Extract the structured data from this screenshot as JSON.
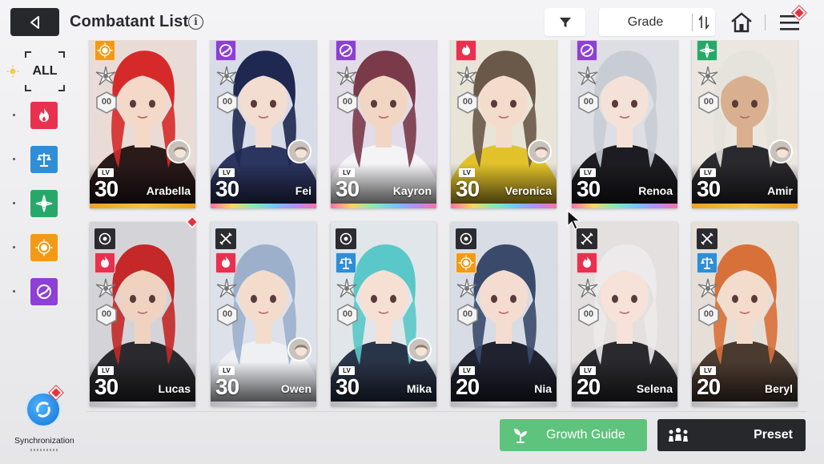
{
  "header": {
    "title": "Combatant List",
    "sort_label": "Grade"
  },
  "filter_rail": {
    "all_label": "ALL",
    "attributes": [
      {
        "id": "fire",
        "color": "#e8314f"
      },
      {
        "id": "order",
        "color": "#2f8ed6"
      },
      {
        "id": "wind",
        "color": "#27a86a"
      },
      {
        "id": "light",
        "color": "#f29a16"
      },
      {
        "id": "void",
        "color": "#8d3fd6"
      }
    ]
  },
  "synchronization": {
    "label": "Synchronization"
  },
  "combatants": [
    {
      "name": "Arabella",
      "level": "30",
      "lv_tag": "LV",
      "attribute": "light",
      "class": "sword",
      "rank": "00",
      "has_partner": true,
      "grade": "orange",
      "art": {
        "hair": "#d62a2a",
        "outfit": "#2a1a1a",
        "skin": "#f4d8c8",
        "bg": "#e9dcd6"
      }
    },
    {
      "name": "Fei",
      "level": "30",
      "lv_tag": "LV",
      "attribute": "void",
      "class": "sword",
      "rank": "00",
      "has_partner": true,
      "grade": "rainbow",
      "art": {
        "hair": "#1e2850",
        "outfit": "#2c3560",
        "skin": "#f3dcd0",
        "bg": "#d8dce8"
      }
    },
    {
      "name": "Kayron",
      "level": "30",
      "lv_tag": "LV",
      "attribute": "void",
      "class": "sword",
      "rank": "00",
      "has_partner": false,
      "grade": "rainbow",
      "art": {
        "hair": "#7a3a4a",
        "outfit": "#f4f4f6",
        "skin": "#f1d6c4",
        "bg": "#e2dce8"
      }
    },
    {
      "name": "Veronica",
      "level": "30",
      "lv_tag": "LV",
      "attribute": "fire",
      "class": "sword",
      "rank": "00",
      "has_partner": true,
      "grade": "rainbow",
      "art": {
        "hair": "#6a5848",
        "outfit": "#e2c22a",
        "skin": "#f4dccc",
        "bg": "#e8e4d8"
      }
    },
    {
      "name": "Renoa",
      "level": "30",
      "lv_tag": "LV",
      "attribute": "void",
      "class": "sword",
      "rank": "00",
      "has_partner": false,
      "grade": "rainbow",
      "art": {
        "hair": "#c8ccd4",
        "outfit": "#1c1c22",
        "skin": "#f4e2d8",
        "bg": "#dedfe4"
      }
    },
    {
      "name": "Amir",
      "level": "30",
      "lv_tag": "LV",
      "attribute": "wind",
      "class": "sword",
      "rank": "00",
      "has_partner": true,
      "grade": "orange",
      "art": {
        "hair": "#e6e2dc",
        "outfit": "#2a2a2e",
        "skin": "#d8b090",
        "bg": "#ece6e0"
      }
    },
    {
      "name": "Lucas",
      "level": "30",
      "lv_tag": "LV",
      "attribute": "fire",
      "class": "target",
      "rank": "00",
      "has_partner": false,
      "grade": "plain",
      "art": {
        "hair": "#c42828",
        "outfit": "#2a2a2e",
        "skin": "#f0d2c0",
        "bg": "#d4d4d8"
      }
    },
    {
      "name": "Owen",
      "level": "30",
      "lv_tag": "LV",
      "attribute": "fire",
      "class": "sword",
      "rank": "00",
      "has_partner": true,
      "grade": "plain",
      "art": {
        "hair": "#9cb0cc",
        "outfit": "#eef0f4",
        "skin": "#f4dccc",
        "bg": "#dde2ea"
      }
    },
    {
      "name": "Mika",
      "level": "30",
      "lv_tag": "LV",
      "attribute": "order",
      "class": "target",
      "rank": "00",
      "has_partner": true,
      "grade": "plain",
      "art": {
        "hair": "#5ac8c8",
        "outfit": "#2a3448",
        "skin": "#f6e0d4",
        "bg": "#e0e6ea"
      }
    },
    {
      "name": "Nia",
      "level": "20",
      "lv_tag": "LV",
      "attribute": "light",
      "class": "target",
      "rank": "00",
      "has_partner": false,
      "grade": "plain",
      "art": {
        "hair": "#3a4a6a",
        "outfit": "#202230",
        "skin": "#f4dcd0",
        "bg": "#d8dce4"
      }
    },
    {
      "name": "Selena",
      "level": "20",
      "lv_tag": "LV",
      "attribute": "fire",
      "class": "sword",
      "rank": "00",
      "has_partner": false,
      "grade": "plain",
      "art": {
        "hair": "#eceaea",
        "outfit": "#2a2a2e",
        "skin": "#f6e2d8",
        "bg": "#e4e0e0"
      }
    },
    {
      "name": "Beryl",
      "level": "20",
      "lv_tag": "LV",
      "attribute": "order",
      "class": "sword",
      "rank": "00",
      "has_partner": false,
      "grade": "plain",
      "art": {
        "hair": "#d8703a",
        "outfit": "#4a3a30",
        "skin": "#f4dccc",
        "bg": "#e6dfd8"
      }
    }
  ],
  "buttons": {
    "growth_guide": "Growth Guide",
    "preset": "Preset"
  },
  "colors": {
    "fire": "#e8314f",
    "order": "#2f8ed6",
    "wind": "#27a86a",
    "light": "#f29a16",
    "void": "#8d3fd6",
    "growth": "#5ec37c",
    "dark": "#26282c",
    "alert": "#e8323c"
  }
}
